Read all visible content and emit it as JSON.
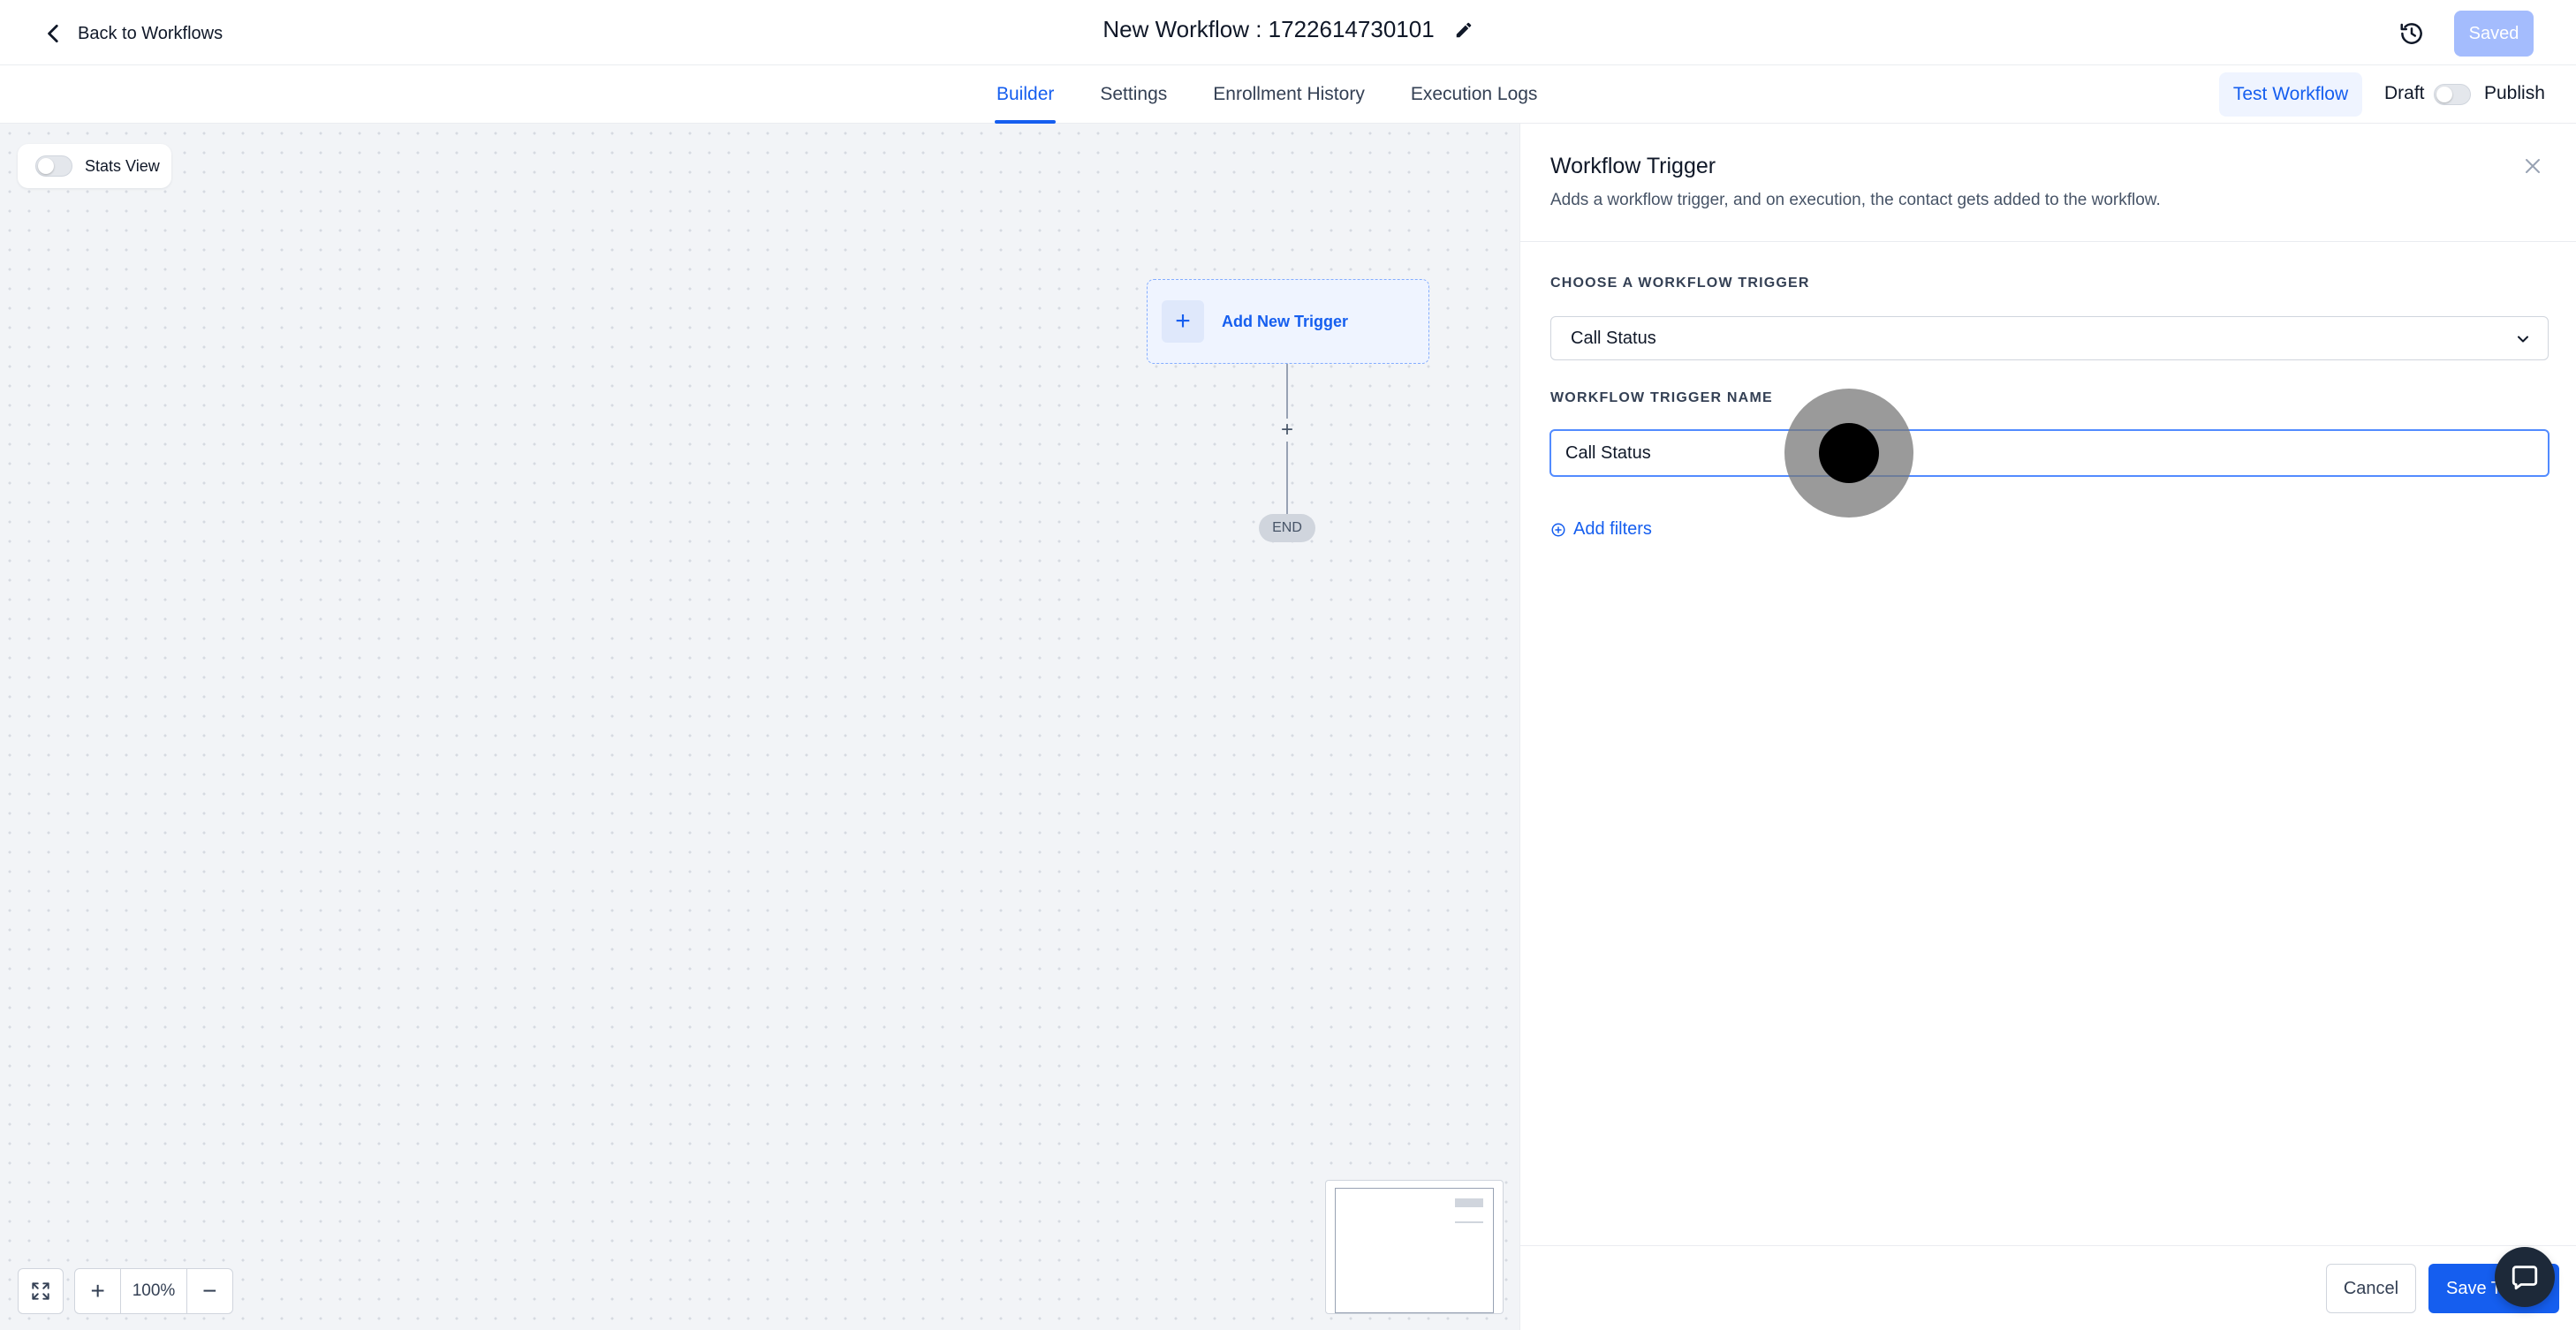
{
  "header": {
    "back_label": "Back to Workflows",
    "workflow_title": "New Workflow : 1722614730101",
    "saved_label": "Saved"
  },
  "tabs": [
    {
      "label": "Builder",
      "active": true
    },
    {
      "label": "Settings",
      "active": false
    },
    {
      "label": "Enrollment History",
      "active": false
    },
    {
      "label": "Execution Logs",
      "active": false
    }
  ],
  "actions": {
    "test_workflow_label": "Test Workflow",
    "draft_label": "Draft",
    "publish_label": "Publish",
    "published": false
  },
  "canvas": {
    "stats_view_label": "Stats View",
    "stats_view_on": false,
    "add_trigger_label": "Add New Trigger",
    "end_label": "END",
    "zoom_level": "100%"
  },
  "panel": {
    "title": "Workflow Trigger",
    "description": "Adds a workflow trigger, and on execution, the contact gets added to the workflow.",
    "choose_trigger_label": "CHOOSE A WORKFLOW TRIGGER",
    "selected_trigger": "Call Status",
    "trigger_name_label": "WORKFLOW TRIGGER NAME",
    "trigger_name_value": "Call Status",
    "add_filters_label": "Add filters",
    "cancel_label": "Cancel",
    "save_label": "Save Trigger"
  },
  "colors": {
    "accent": "#155eef",
    "saved_button": "#a4bcfd",
    "canvas_bg": "#f2f4f7",
    "trigger_node_bg": "#eff4ff"
  },
  "icons": {
    "back": "chevron-left-icon",
    "edit": "pencil-icon",
    "history": "history-clock-icon",
    "close": "close-icon",
    "dropdown": "chevron-down-icon",
    "add_filters": "plus-circle-icon",
    "fit_view": "expand-icon",
    "chat": "chat-bubble-icon"
  }
}
